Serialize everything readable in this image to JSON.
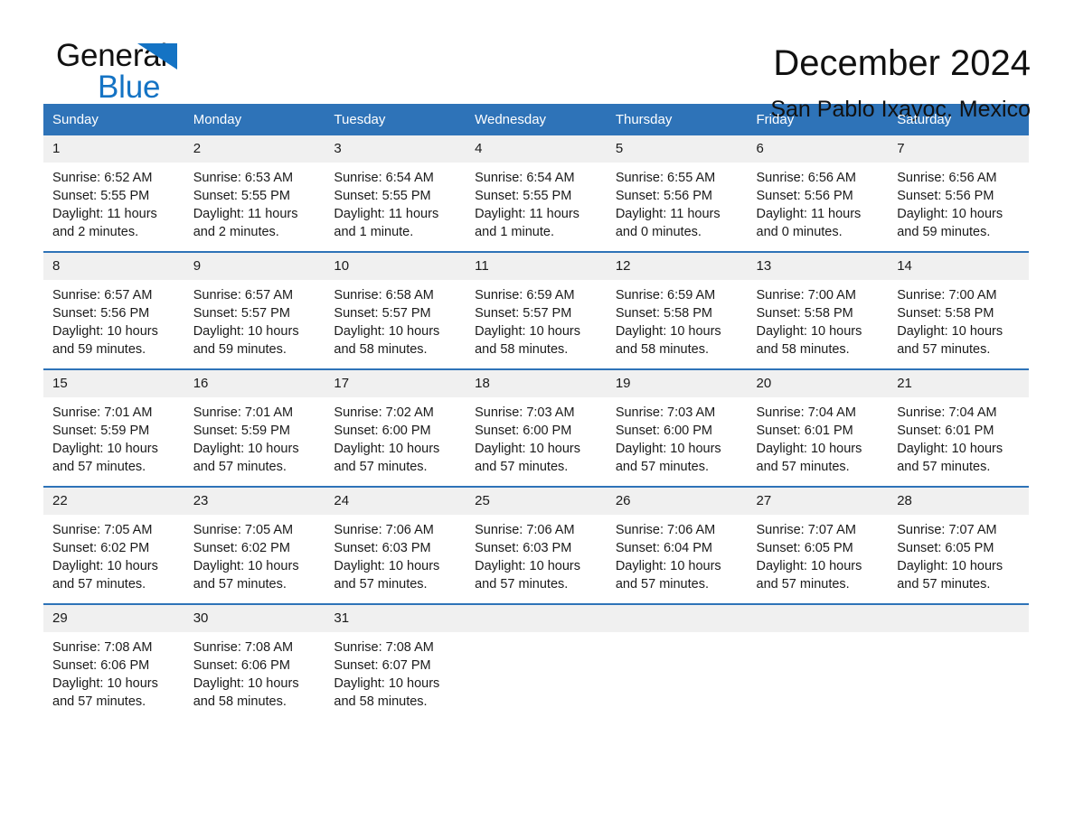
{
  "brand": {
    "line1": "General",
    "line2": "Blue",
    "triangle_color": "#1473c4"
  },
  "header": {
    "month_title": "December 2024",
    "location": "San Pablo Ixayoc, Mexico"
  },
  "theme": {
    "header_blue": "#2e73b8",
    "daynum_band": "#f0f0f0",
    "text": "#1a1a1a"
  },
  "calendar": {
    "weekday_headers": [
      "Sunday",
      "Monday",
      "Tuesday",
      "Wednesday",
      "Thursday",
      "Friday",
      "Saturday"
    ],
    "weeks": [
      [
        {
          "day": "1",
          "sunrise": "Sunrise: 6:52 AM",
          "sunset": "Sunset: 5:55 PM",
          "daylight_line1": "Daylight: 11 hours",
          "daylight_line2": "and 2 minutes."
        },
        {
          "day": "2",
          "sunrise": "Sunrise: 6:53 AM",
          "sunset": "Sunset: 5:55 PM",
          "daylight_line1": "Daylight: 11 hours",
          "daylight_line2": "and 2 minutes."
        },
        {
          "day": "3",
          "sunrise": "Sunrise: 6:54 AM",
          "sunset": "Sunset: 5:55 PM",
          "daylight_line1": "Daylight: 11 hours",
          "daylight_line2": "and 1 minute."
        },
        {
          "day": "4",
          "sunrise": "Sunrise: 6:54 AM",
          "sunset": "Sunset: 5:55 PM",
          "daylight_line1": "Daylight: 11 hours",
          "daylight_line2": "and 1 minute."
        },
        {
          "day": "5",
          "sunrise": "Sunrise: 6:55 AM",
          "sunset": "Sunset: 5:56 PM",
          "daylight_line1": "Daylight: 11 hours",
          "daylight_line2": "and 0 minutes."
        },
        {
          "day": "6",
          "sunrise": "Sunrise: 6:56 AM",
          "sunset": "Sunset: 5:56 PM",
          "daylight_line1": "Daylight: 11 hours",
          "daylight_line2": "and 0 minutes."
        },
        {
          "day": "7",
          "sunrise": "Sunrise: 6:56 AM",
          "sunset": "Sunset: 5:56 PM",
          "daylight_line1": "Daylight: 10 hours",
          "daylight_line2": "and 59 minutes."
        }
      ],
      [
        {
          "day": "8",
          "sunrise": "Sunrise: 6:57 AM",
          "sunset": "Sunset: 5:56 PM",
          "daylight_line1": "Daylight: 10 hours",
          "daylight_line2": "and 59 minutes."
        },
        {
          "day": "9",
          "sunrise": "Sunrise: 6:57 AM",
          "sunset": "Sunset: 5:57 PM",
          "daylight_line1": "Daylight: 10 hours",
          "daylight_line2": "and 59 minutes."
        },
        {
          "day": "10",
          "sunrise": "Sunrise: 6:58 AM",
          "sunset": "Sunset: 5:57 PM",
          "daylight_line1": "Daylight: 10 hours",
          "daylight_line2": "and 58 minutes."
        },
        {
          "day": "11",
          "sunrise": "Sunrise: 6:59 AM",
          "sunset": "Sunset: 5:57 PM",
          "daylight_line1": "Daylight: 10 hours",
          "daylight_line2": "and 58 minutes."
        },
        {
          "day": "12",
          "sunrise": "Sunrise: 6:59 AM",
          "sunset": "Sunset: 5:58 PM",
          "daylight_line1": "Daylight: 10 hours",
          "daylight_line2": "and 58 minutes."
        },
        {
          "day": "13",
          "sunrise": "Sunrise: 7:00 AM",
          "sunset": "Sunset: 5:58 PM",
          "daylight_line1": "Daylight: 10 hours",
          "daylight_line2": "and 58 minutes."
        },
        {
          "day": "14",
          "sunrise": "Sunrise: 7:00 AM",
          "sunset": "Sunset: 5:58 PM",
          "daylight_line1": "Daylight: 10 hours",
          "daylight_line2": "and 57 minutes."
        }
      ],
      [
        {
          "day": "15",
          "sunrise": "Sunrise: 7:01 AM",
          "sunset": "Sunset: 5:59 PM",
          "daylight_line1": "Daylight: 10 hours",
          "daylight_line2": "and 57 minutes."
        },
        {
          "day": "16",
          "sunrise": "Sunrise: 7:01 AM",
          "sunset": "Sunset: 5:59 PM",
          "daylight_line1": "Daylight: 10 hours",
          "daylight_line2": "and 57 minutes."
        },
        {
          "day": "17",
          "sunrise": "Sunrise: 7:02 AM",
          "sunset": "Sunset: 6:00 PM",
          "daylight_line1": "Daylight: 10 hours",
          "daylight_line2": "and 57 minutes."
        },
        {
          "day": "18",
          "sunrise": "Sunrise: 7:03 AM",
          "sunset": "Sunset: 6:00 PM",
          "daylight_line1": "Daylight: 10 hours",
          "daylight_line2": "and 57 minutes."
        },
        {
          "day": "19",
          "sunrise": "Sunrise: 7:03 AM",
          "sunset": "Sunset: 6:00 PM",
          "daylight_line1": "Daylight: 10 hours",
          "daylight_line2": "and 57 minutes."
        },
        {
          "day": "20",
          "sunrise": "Sunrise: 7:04 AM",
          "sunset": "Sunset: 6:01 PM",
          "daylight_line1": "Daylight: 10 hours",
          "daylight_line2": "and 57 minutes."
        },
        {
          "day": "21",
          "sunrise": "Sunrise: 7:04 AM",
          "sunset": "Sunset: 6:01 PM",
          "daylight_line1": "Daylight: 10 hours",
          "daylight_line2": "and 57 minutes."
        }
      ],
      [
        {
          "day": "22",
          "sunrise": "Sunrise: 7:05 AM",
          "sunset": "Sunset: 6:02 PM",
          "daylight_line1": "Daylight: 10 hours",
          "daylight_line2": "and 57 minutes."
        },
        {
          "day": "23",
          "sunrise": "Sunrise: 7:05 AM",
          "sunset": "Sunset: 6:02 PM",
          "daylight_line1": "Daylight: 10 hours",
          "daylight_line2": "and 57 minutes."
        },
        {
          "day": "24",
          "sunrise": "Sunrise: 7:06 AM",
          "sunset": "Sunset: 6:03 PM",
          "daylight_line1": "Daylight: 10 hours",
          "daylight_line2": "and 57 minutes."
        },
        {
          "day": "25",
          "sunrise": "Sunrise: 7:06 AM",
          "sunset": "Sunset: 6:03 PM",
          "daylight_line1": "Daylight: 10 hours",
          "daylight_line2": "and 57 minutes."
        },
        {
          "day": "26",
          "sunrise": "Sunrise: 7:06 AM",
          "sunset": "Sunset: 6:04 PM",
          "daylight_line1": "Daylight: 10 hours",
          "daylight_line2": "and 57 minutes."
        },
        {
          "day": "27",
          "sunrise": "Sunrise: 7:07 AM",
          "sunset": "Sunset: 6:05 PM",
          "daylight_line1": "Daylight: 10 hours",
          "daylight_line2": "and 57 minutes."
        },
        {
          "day": "28",
          "sunrise": "Sunrise: 7:07 AM",
          "sunset": "Sunset: 6:05 PM",
          "daylight_line1": "Daylight: 10 hours",
          "daylight_line2": "and 57 minutes."
        }
      ],
      [
        {
          "day": "29",
          "sunrise": "Sunrise: 7:08 AM",
          "sunset": "Sunset: 6:06 PM",
          "daylight_line1": "Daylight: 10 hours",
          "daylight_line2": "and 57 minutes."
        },
        {
          "day": "30",
          "sunrise": "Sunrise: 7:08 AM",
          "sunset": "Sunset: 6:06 PM",
          "daylight_line1": "Daylight: 10 hours",
          "daylight_line2": "and 58 minutes."
        },
        {
          "day": "31",
          "sunrise": "Sunrise: 7:08 AM",
          "sunset": "Sunset: 6:07 PM",
          "daylight_line1": "Daylight: 10 hours",
          "daylight_line2": "and 58 minutes."
        },
        {
          "day": "",
          "sunrise": "",
          "sunset": "",
          "daylight_line1": "",
          "daylight_line2": ""
        },
        {
          "day": "",
          "sunrise": "",
          "sunset": "",
          "daylight_line1": "",
          "daylight_line2": ""
        },
        {
          "day": "",
          "sunrise": "",
          "sunset": "",
          "daylight_line1": "",
          "daylight_line2": ""
        },
        {
          "day": "",
          "sunrise": "",
          "sunset": "",
          "daylight_line1": "",
          "daylight_line2": ""
        }
      ]
    ]
  }
}
